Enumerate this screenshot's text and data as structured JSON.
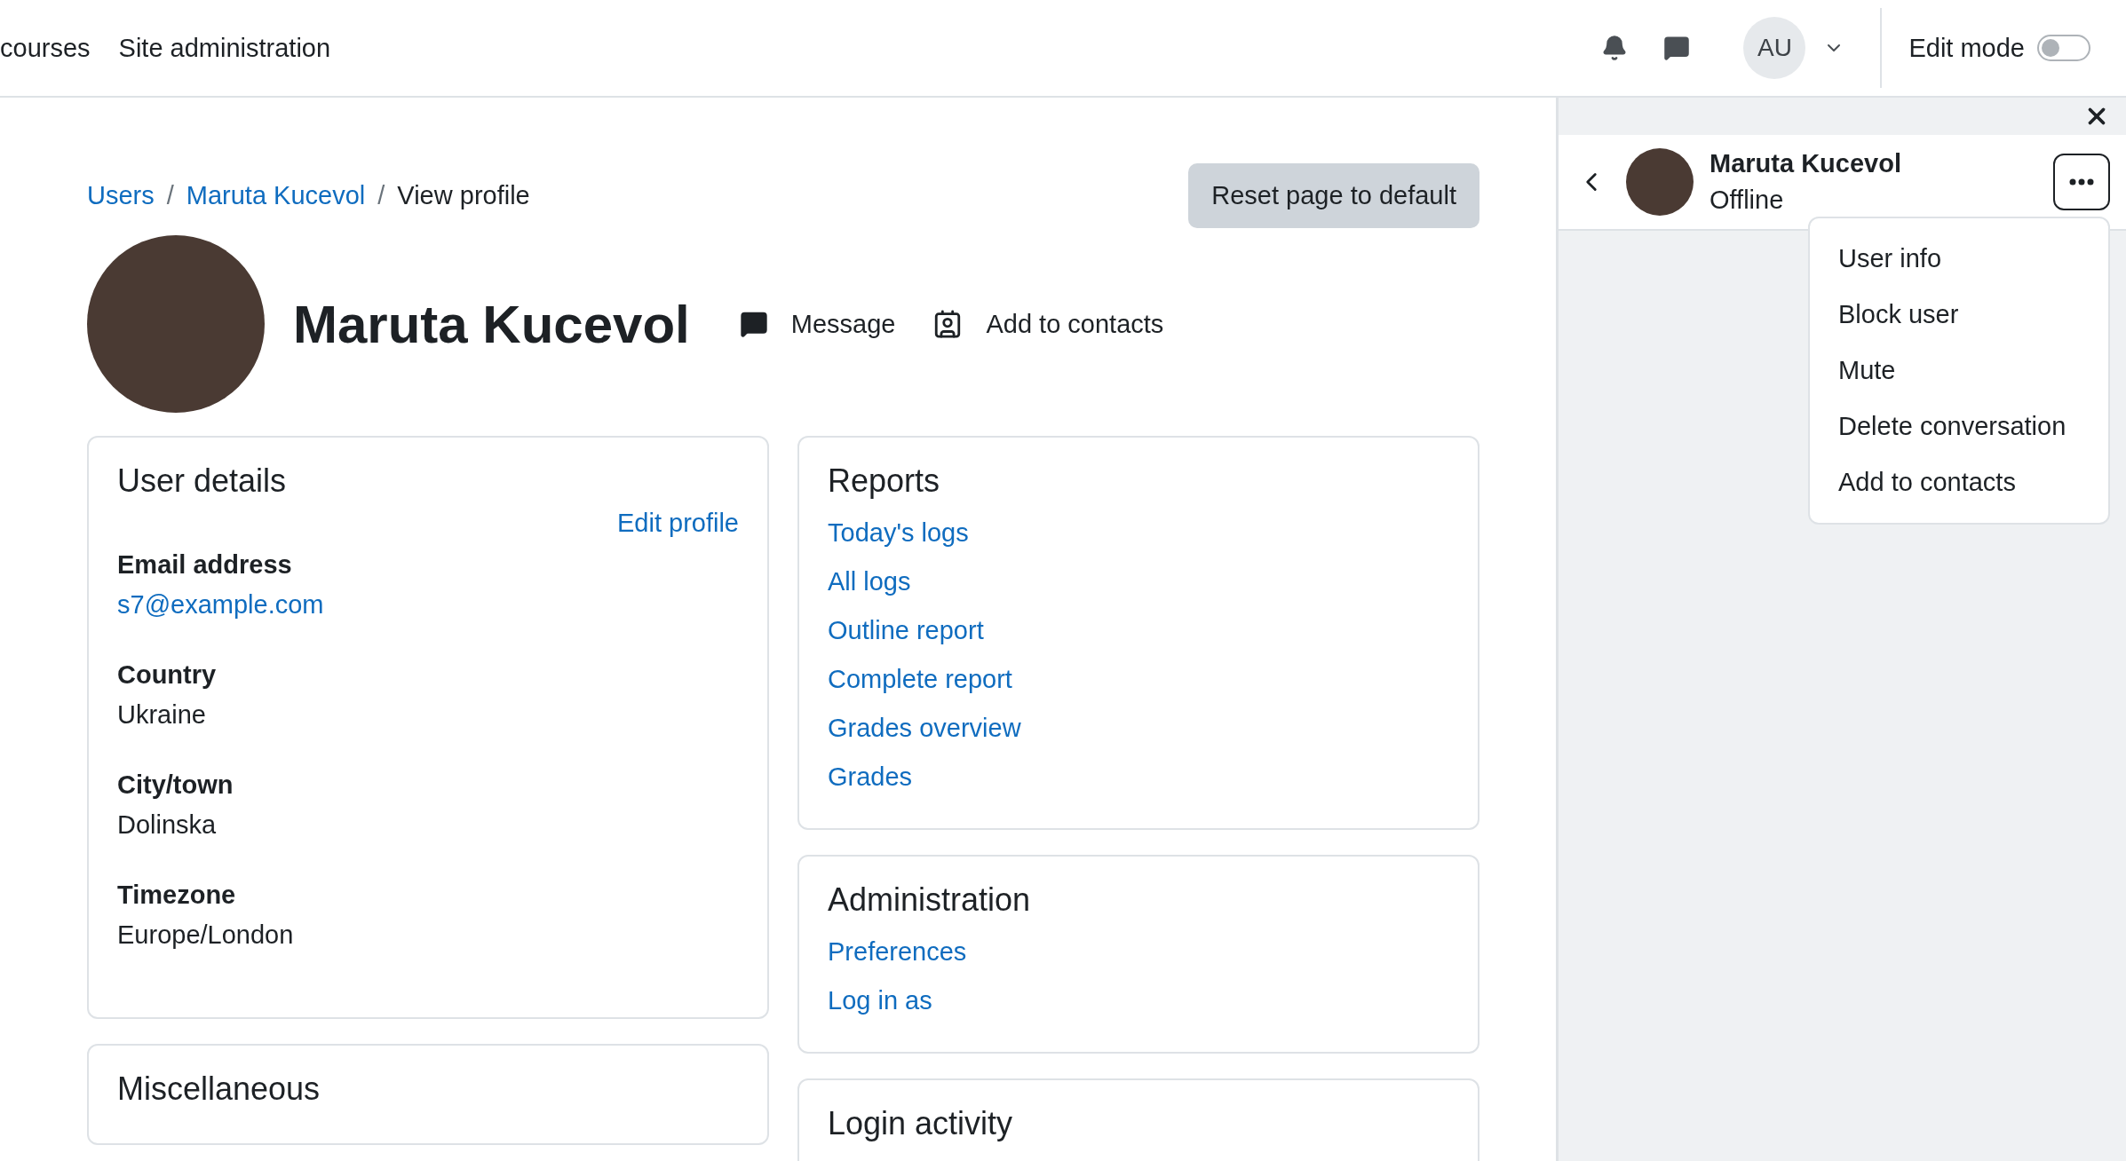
{
  "navbar": {
    "links": [
      "courses",
      "Site administration"
    ],
    "user_initials": "AU",
    "edit_mode": {
      "label": "Edit mode",
      "on": false
    }
  },
  "breadcrumb": [
    "Users",
    "Maruta Kucevol",
    "View profile"
  ],
  "breadcrumb_separator": "/",
  "reset_button": "Reset page to default",
  "profile": {
    "name": "Maruta Kucevol",
    "actions": [
      {
        "kind": "message",
        "label": "Message"
      },
      {
        "kind": "contact",
        "label": "Add to contacts"
      }
    ]
  },
  "left_cards": [
    {
      "title": "User details",
      "edit_link": "Edit profile",
      "fields": [
        {
          "label": "Email address",
          "value": "s7@example.com",
          "link": true
        },
        {
          "label": "Country",
          "value": "Ukraine",
          "link": false
        },
        {
          "label": "City/town",
          "value": "Dolinska",
          "link": false
        },
        {
          "label": "Timezone",
          "value": "Europe/London",
          "link": false
        }
      ]
    },
    {
      "title": "Miscellaneous"
    }
  ],
  "right_cards": [
    {
      "title": "Reports",
      "links": [
        "Today's logs",
        "All logs",
        "Outline report",
        "Complete report",
        "Grades overview",
        "Grades"
      ]
    },
    {
      "title": "Administration",
      "links": [
        "Preferences",
        "Log in as"
      ]
    },
    {
      "title": "Login activity"
    }
  ],
  "drawer": {
    "name": "Maruta Kucevol",
    "status": "Offline",
    "menu_open": true,
    "menu": [
      "User info",
      "Block user",
      "Mute",
      "Delete conversation",
      "Add to contacts"
    ]
  }
}
